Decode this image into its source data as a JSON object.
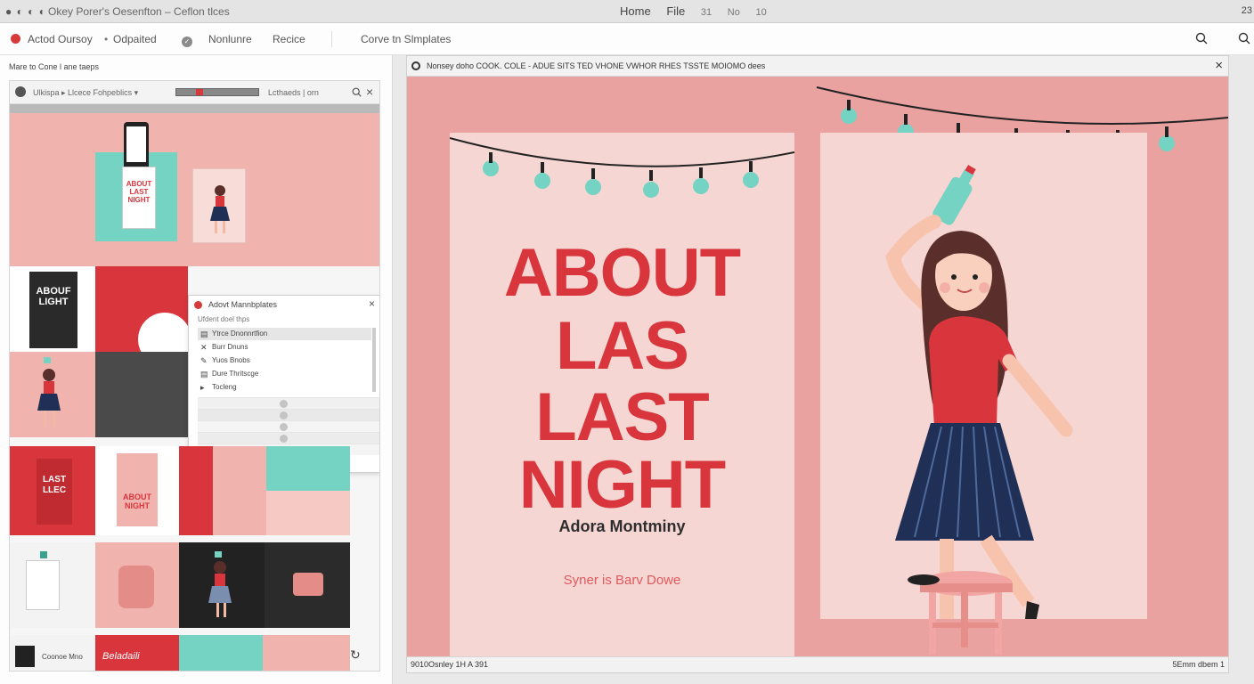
{
  "titlebar": {
    "dots": "● ◐ ◐ ◐",
    "app_title": "Okey Porer's Oesenfton – Ceflon tlces",
    "menu": [
      "Home",
      "File",
      "31",
      "No",
      "10"
    ],
    "right": "23"
  },
  "toolbar": {
    "item1": "Actod Oursoy",
    "item2": "Odpaited",
    "item3": "Nonlunre",
    "item4": "Recice",
    "item5": "Corve tn Slmplates"
  },
  "left_panel": {
    "label": "Mare to Cone l ane taeps",
    "inner_bar": {
      "breadcrumb": "Ulkispa ▸  Llcece Fohpeblics ▾",
      "right_text": "Lcthaeds | orn"
    },
    "tiles": {
      "card1_text": "ABOUT LAST NIGHT",
      "book_dark_text": "ABOUF LIGHT",
      "bag_text": "LAST LLEC",
      "card_pink_text": "ABOUT NIGHT",
      "bottom_text1": "Coonoe Mno",
      "bottom_text2": "Beladaili"
    },
    "popup": {
      "header": "Adovt Mannbplates",
      "sub": "Ufdent doel thps",
      "items": [
        {
          "icon": "▤",
          "label": "Ytrce Dnonnrtfion"
        },
        {
          "icon": "✕",
          "label": "Burr Dnuns"
        },
        {
          "icon": "✎",
          "label": "Yuos Bnobs"
        },
        {
          "icon": "▤",
          "label": "Dure Thritscge"
        },
        {
          "icon": "▸",
          "label": "Tocleng"
        }
      ]
    }
  },
  "preview": {
    "tab_title": "Nonsey doho   COOK. COLE  -  ADUE SITS  TED VHONE  VWHOR RHES TSSTE MOIOMO dees",
    "status_left": "9010Osnley 1H A 391",
    "status_right": "5Emm dbem 1",
    "poster": {
      "title_lines": [
        "ABOUT",
        "LAS",
        "LAST",
        "NIGHT"
      ],
      "author": "Adora Montminy",
      "tagline": "Syner is Barv Dowe"
    }
  },
  "colors": {
    "accent_red": "#d8353c",
    "pink_bg": "#e9a2a0",
    "pale_pink": "#f6d6d3",
    "mint": "#72d6c6",
    "navy": "#1f2f55"
  }
}
